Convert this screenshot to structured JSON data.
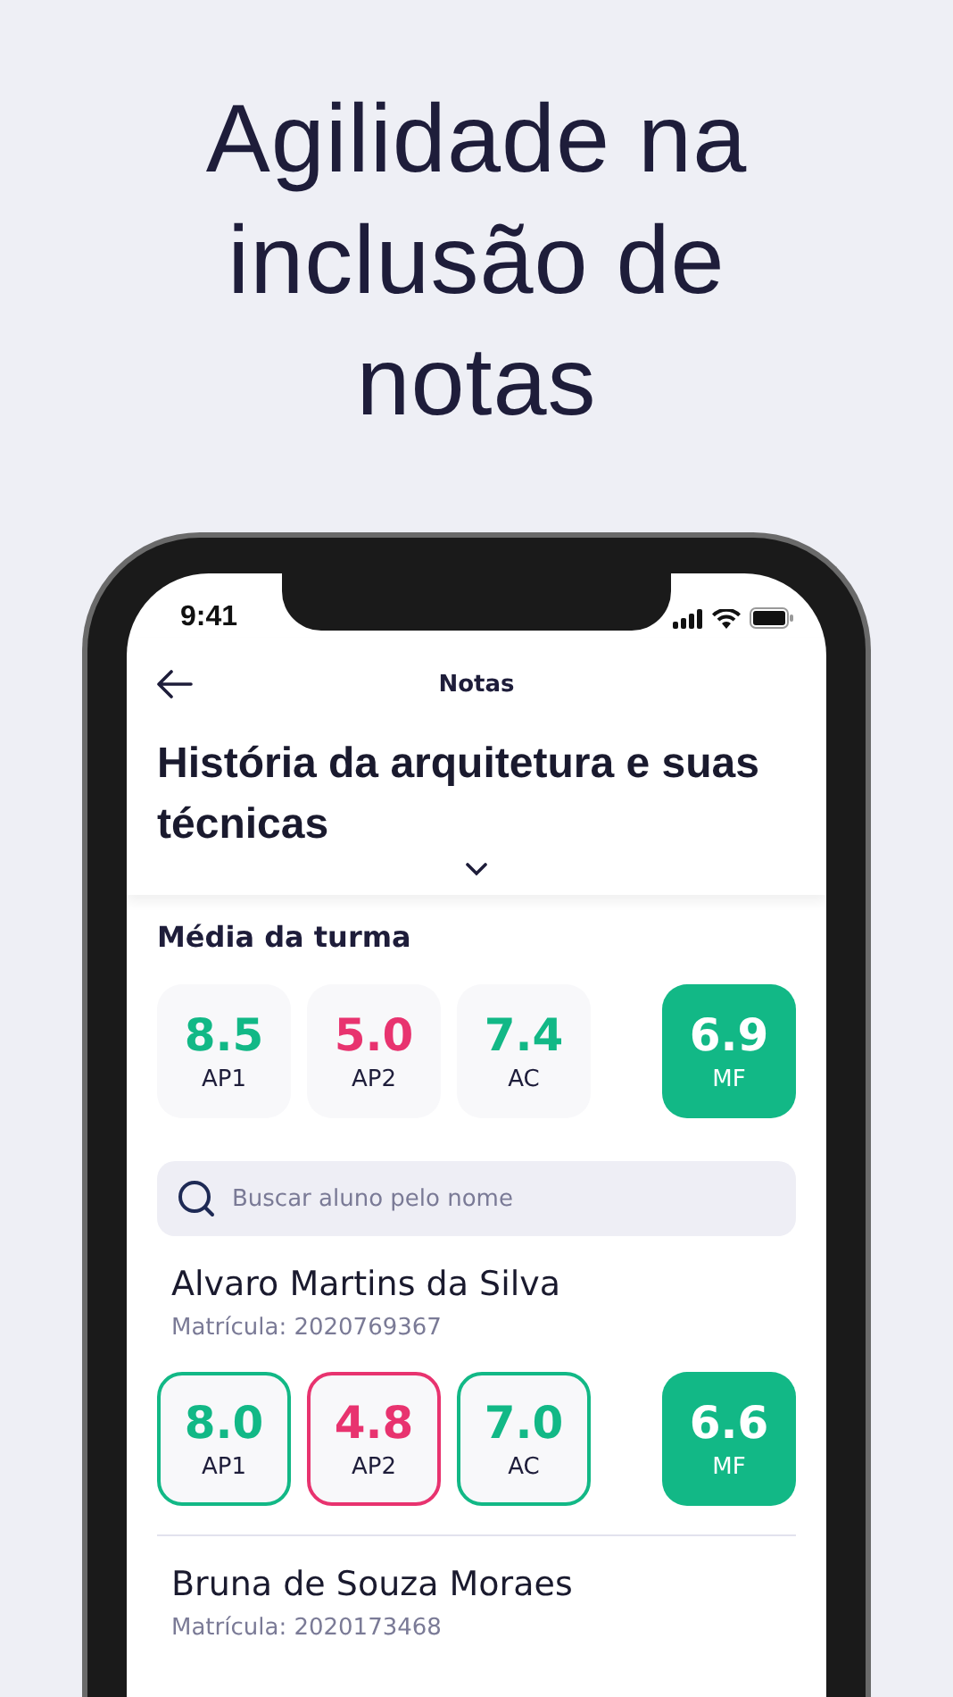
{
  "headline": [
    "Agilidade na",
    "inclusão de",
    "notas"
  ],
  "status_bar": {
    "time": "9:41"
  },
  "nav": {
    "title": "Notas"
  },
  "course": {
    "title": "História da arquitetura e suas técnicas",
    "expanded": false
  },
  "class_average": {
    "label": "Média da turma",
    "grades": [
      {
        "value": "8.5",
        "label": "AP1",
        "kind": "plain",
        "color": "#12b886"
      },
      {
        "value": "5.0",
        "label": "AP2",
        "kind": "plain",
        "color": "#e8336f"
      },
      {
        "value": "7.4",
        "label": "AC",
        "kind": "plain",
        "color": "#12b886"
      },
      {
        "value": "6.9",
        "label": "MF",
        "kind": "final",
        "color": "#12b886"
      }
    ]
  },
  "search": {
    "placeholder": "Buscar aluno pelo nome"
  },
  "students": [
    {
      "name": "Alvaro Martins da Silva",
      "id": "Matrícula: 2020769367",
      "grades": [
        {
          "value": "8.0",
          "label": "AP1",
          "kind": "outlined",
          "color": "#12b886"
        },
        {
          "value": "4.8",
          "label": "AP2",
          "kind": "outlined",
          "color": "#e8336f"
        },
        {
          "value": "7.0",
          "label": "AC",
          "kind": "outlined",
          "color": "#12b886"
        },
        {
          "value": "6.6",
          "label": "MF",
          "kind": "final",
          "color": "#12b886"
        }
      ]
    },
    {
      "name": "Bruna de Souza Moraes",
      "id": "Matrícula: 2020173468"
    }
  ]
}
